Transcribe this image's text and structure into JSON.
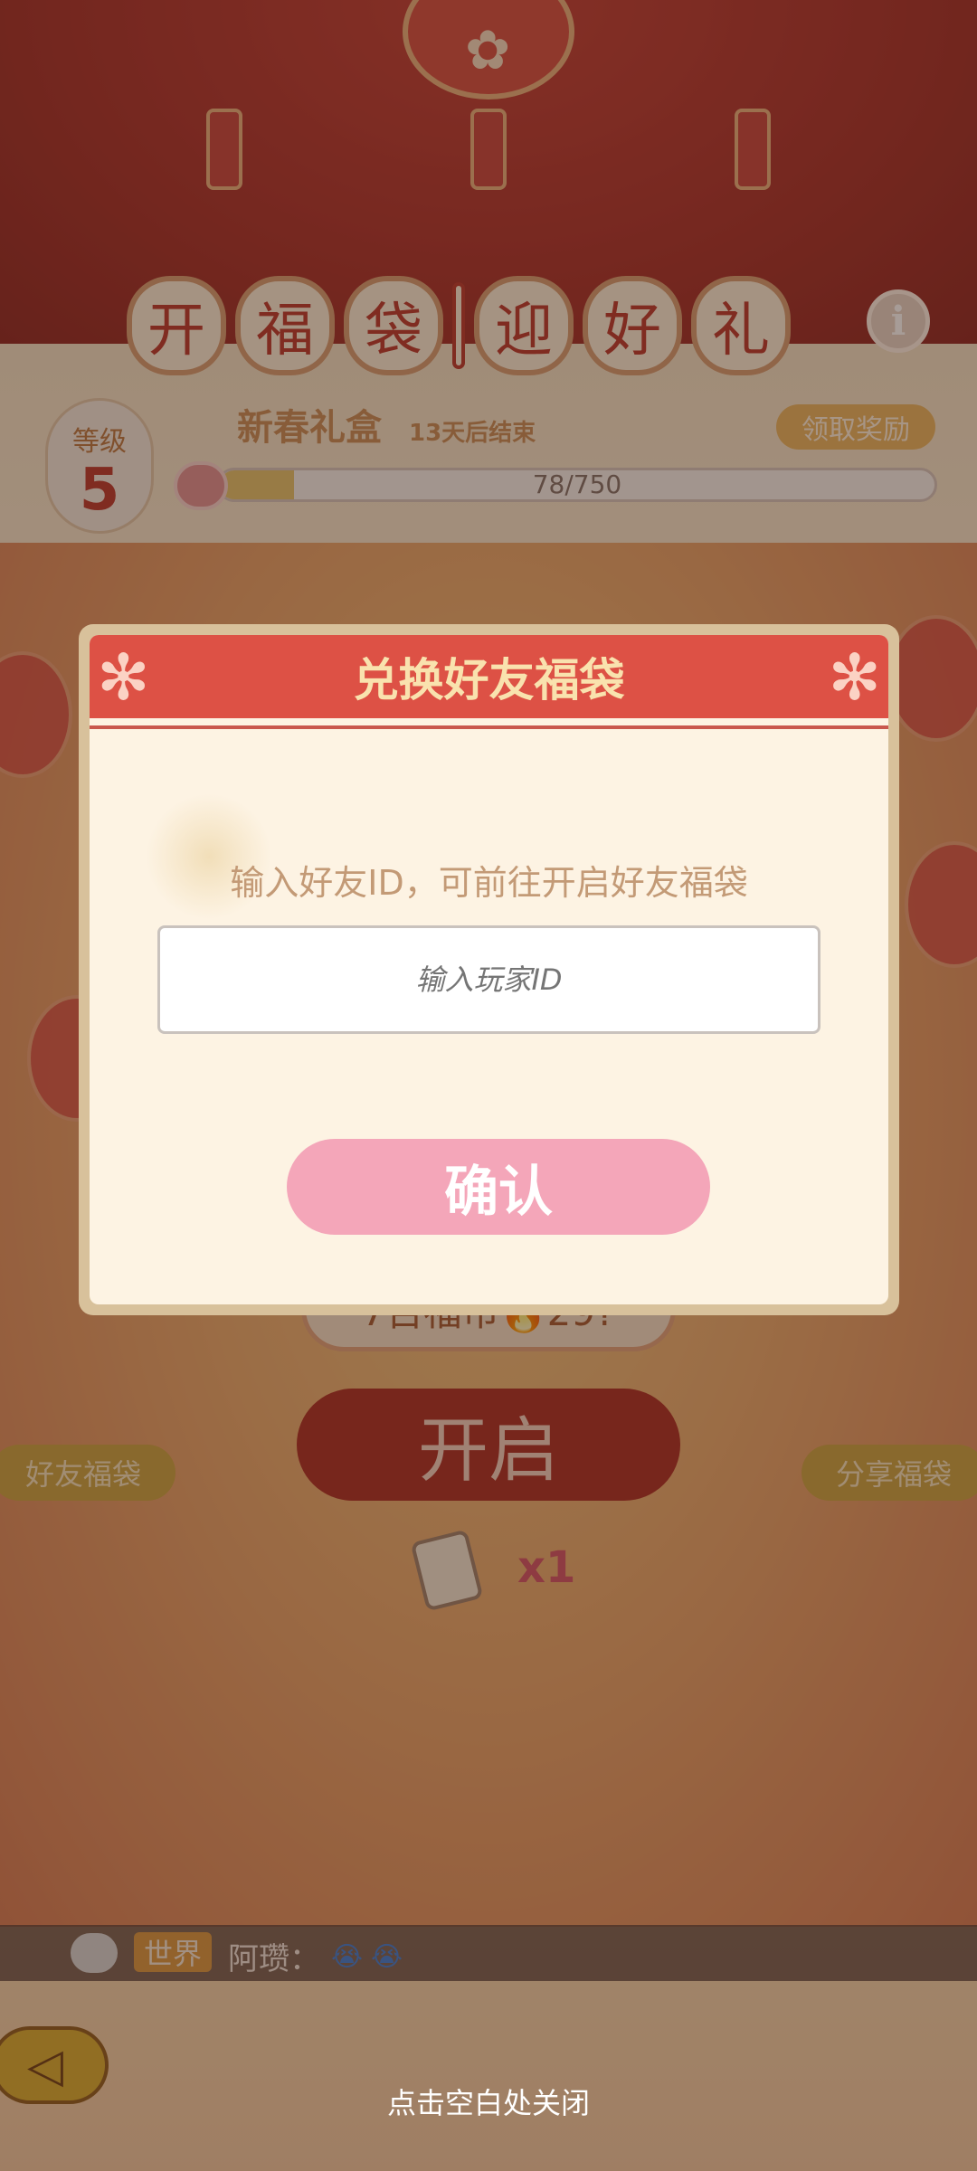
{
  "header": {
    "title_chars": [
      "开",
      "福",
      "袋",
      "迎",
      "好",
      "礼"
    ],
    "info_icon": "info-icon"
  },
  "level": {
    "label": "等级",
    "value": "5"
  },
  "event": {
    "name": "新春礼盒",
    "time_left": "13天后结束",
    "claim_label": "领取奖励",
    "progress_text": "78/750",
    "progress_fraction": 0.104
  },
  "background_ui": {
    "coin_pill_text": "7百福市🔥29?",
    "open_label": "开启",
    "friend_bag_label": "好友福袋",
    "share_bag_label": "分享福袋",
    "ticket_count": "x1"
  },
  "chat": {
    "channel": "世界",
    "message": "阿瓒：",
    "emojis": [
      "😭",
      "😭"
    ]
  },
  "modal": {
    "title": "兑换好友福袋",
    "description": "输入好友ID，可前往开启好友福袋",
    "input_placeholder": "输入玩家ID",
    "confirm_label": "确认"
  },
  "close_hint": "点击空白处关闭"
}
